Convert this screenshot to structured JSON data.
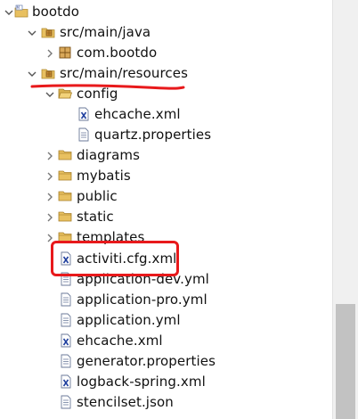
{
  "tree": {
    "project": {
      "label": "bootdo",
      "icon": "project-icon",
      "expanded": true
    },
    "src_main_java": {
      "label": "src/main/java",
      "icon": "source-folder-icon",
      "expanded": true
    },
    "com_bootdo": {
      "label": "com.bootdo",
      "icon": "package-icon",
      "expanded": false
    },
    "src_main_resources": {
      "label": "src/main/resources",
      "icon": "source-folder-icon",
      "expanded": true
    },
    "config": {
      "label": "config",
      "icon": "folder-icon",
      "expanded": true
    },
    "ehcache_config": {
      "label": "ehcache.xml",
      "icon": "xml-file-icon"
    },
    "quartz": {
      "label": "quartz.properties",
      "icon": "text-file-icon"
    },
    "diagrams": {
      "label": "diagrams",
      "icon": "folder-icon",
      "expanded": false
    },
    "mybatis": {
      "label": "mybatis",
      "icon": "folder-icon",
      "expanded": false
    },
    "public": {
      "label": "public",
      "icon": "folder-icon",
      "expanded": false
    },
    "static": {
      "label": "static",
      "icon": "folder-icon",
      "expanded": false
    },
    "templates": {
      "label": "templates",
      "icon": "folder-icon",
      "expanded": false
    },
    "activiti": {
      "label": "activiti.cfg.xml",
      "icon": "xml-file-icon"
    },
    "app_dev": {
      "label": "application-dev.yml",
      "icon": "text-file-icon"
    },
    "app_pro": {
      "label": "application-pro.yml",
      "icon": "text-file-icon"
    },
    "app": {
      "label": "application.yml",
      "icon": "text-file-icon"
    },
    "ehcache": {
      "label": "ehcache.xml",
      "icon": "xml-file-icon"
    },
    "generator": {
      "label": "generator.properties",
      "icon": "text-file-icon"
    },
    "logback": {
      "label": "logback-spring.xml",
      "icon": "xml-file-icon"
    },
    "stencilset": {
      "label": "stencilset.json",
      "icon": "text-file-icon"
    }
  },
  "annotations": {
    "color": "#e8191b",
    "underlined_item": "src/main/resources",
    "boxed_item": "activiti.cfg.xml"
  },
  "colors": {
    "folder": "#e8c060",
    "package": "#a8703a",
    "xml_x": "#1f3f9e",
    "jar_brown": "#c78a32"
  }
}
